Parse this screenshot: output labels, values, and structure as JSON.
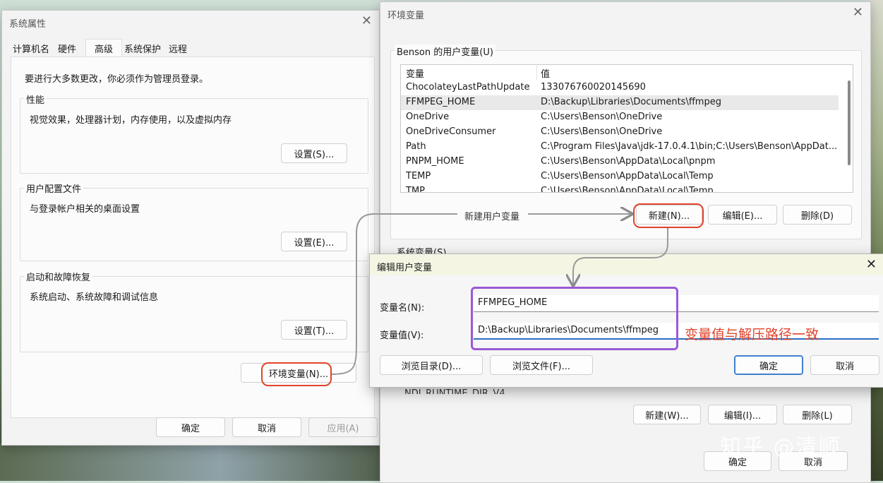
{
  "sysprops": {
    "title": "系统属性",
    "tabs": [
      "计算机名",
      "硬件",
      "高级",
      "系统保护",
      "远程"
    ],
    "active_tab": "高级",
    "admin_note": "要进行大多数更改，你必须作为管理员登录。",
    "perf": {
      "label": "性能",
      "desc": "视觉效果，处理器计划，内存使用，以及虚拟内存",
      "button": "设置(S)..."
    },
    "profile": {
      "label": "用户配置文件",
      "desc": "与登录帐户相关的桌面设置",
      "button": "设置(E)..."
    },
    "startup": {
      "label": "启动和故障恢复",
      "desc": "系统启动、系统故障和调试信息",
      "button": "设置(T)..."
    },
    "env_button": "环境变量(N)...",
    "ok": "确定",
    "cancel": "取消",
    "apply": "应用(A)"
  },
  "envvars": {
    "title": "环境变量",
    "user_group": "Benson 的用户变量(U)",
    "columns": [
      "变量",
      "值"
    ],
    "user_rows": [
      {
        "name": "ChocolateyLastPathUpdate",
        "value": "133076760020145690"
      },
      {
        "name": "FFMPEG_HOME",
        "value": "D:\\Backup\\Libraries\\Documents\\ffmpeg"
      },
      {
        "name": "OneDrive",
        "value": "C:\\Users\\Benson\\OneDrive"
      },
      {
        "name": "OneDriveConsumer",
        "value": "C:\\Users\\Benson\\OneDrive"
      },
      {
        "name": "Path",
        "value": "C:\\Program Files\\Java\\jdk-17.0.4.1\\bin;C:\\Users\\Benson\\AppDat..."
      },
      {
        "name": "PNPM_HOME",
        "value": "C:\\Users\\Benson\\AppData\\Local\\pnpm"
      },
      {
        "name": "TEMP",
        "value": "C:\\Users\\Benson\\AppData\\Local\\Temp"
      },
      {
        "name": "TMP",
        "value": "C:\\Users\\Benson\\AppData\\Local\\Temp"
      }
    ],
    "selected_row": 1,
    "user_buttons": {
      "new": "新建(N)...",
      "edit": "编辑(E)...",
      "delete": "删除(D)"
    },
    "system_group": "系统变量(S)",
    "system_partial_row": "NDI_RUNTIME_DIR_V4",
    "system_buttons": {
      "new": "新建(W)...",
      "edit": "编辑(I)...",
      "delete": "删除(L)"
    },
    "ok": "确定",
    "cancel": "取消"
  },
  "editdlg": {
    "title": "编辑用户变量",
    "name_label": "变量名(N):",
    "name_value": "FFMPEG_HOME",
    "value_label": "变量值(V):",
    "value_value": "D:\\Backup\\Libraries\\Documents\\ffmpeg",
    "browse_dir": "浏览目录(D)...",
    "browse_file": "浏览文件(F)...",
    "ok": "确定",
    "cancel": "取消"
  },
  "annotations": {
    "new_user_var": "新建用户变量",
    "value_note": "变量值与解压路径一致",
    "watermark": "知乎 @清顺"
  }
}
